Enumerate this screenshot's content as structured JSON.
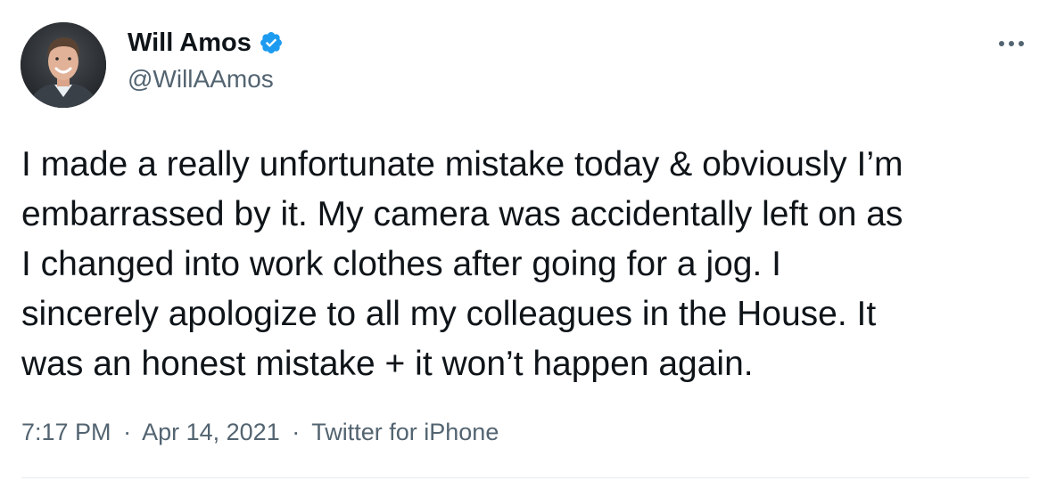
{
  "tweet": {
    "author": {
      "display_name": "Will Amos",
      "handle": "@WillAAmos",
      "verified": true,
      "avatar_icon": "profile-photo"
    },
    "more_icon": "more-horizontal-icon",
    "text_lines": [
      "I made a really unfortunate mistake today & obviously I’m",
      "embarrassed by it. My camera was accidentally left on as",
      "I changed into work clothes after going for a jog. I",
      "sincerely apologize to all my colleagues in the House. It",
      "was an honest mistake + it won’t happen again."
    ],
    "time": "7:17 PM",
    "date": "Apr 14, 2021",
    "source": "Twitter for iPhone",
    "separator": "·"
  },
  "colors": {
    "verified_badge": "#1d9bf0",
    "secondary_text": "#536471",
    "primary_text": "#0f1419",
    "divider": "#e7ecf0"
  }
}
